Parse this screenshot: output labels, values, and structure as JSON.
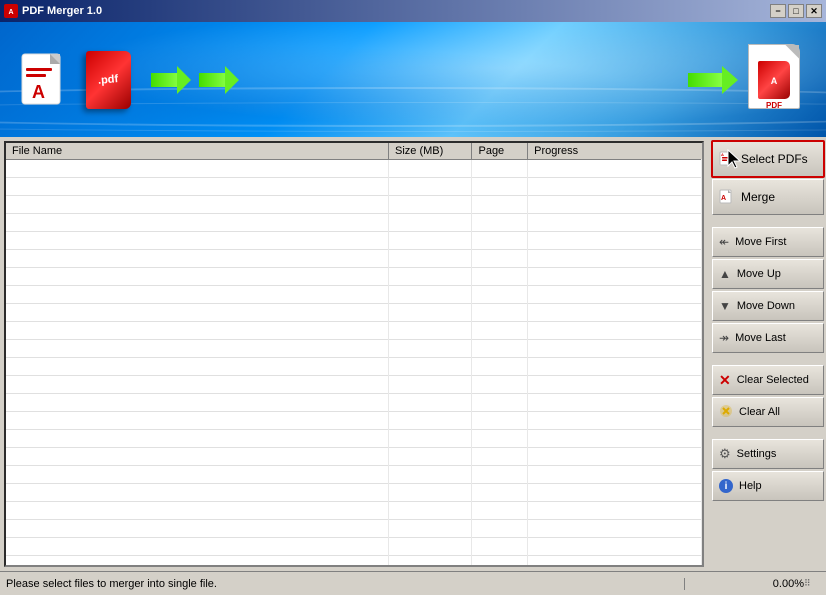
{
  "window": {
    "title": "PDF Merger 1.0",
    "min_label": "−",
    "max_label": "□",
    "close_label": "✕"
  },
  "table": {
    "columns": [
      {
        "key": "filename",
        "label": "File Name",
        "width": "55%"
      },
      {
        "key": "size",
        "label": "Size (MB)",
        "width": "12%"
      },
      {
        "key": "page",
        "label": "Page",
        "width": "8%"
      },
      {
        "key": "progress",
        "label": "Progress",
        "width": "25%"
      }
    ],
    "rows": []
  },
  "buttons": {
    "select_pdfs": "Select PDFs",
    "merge": "Merge",
    "move_first": "Move First",
    "move_up": "Move Up",
    "move_down": "Move Down",
    "move_last": "Move Last",
    "clear_selected": "Clear Selected",
    "clear_all": "Clear All",
    "settings": "Settings",
    "help": "Help"
  },
  "status": {
    "message": "Please select files to merger into single file.",
    "progress": "0.00%"
  }
}
